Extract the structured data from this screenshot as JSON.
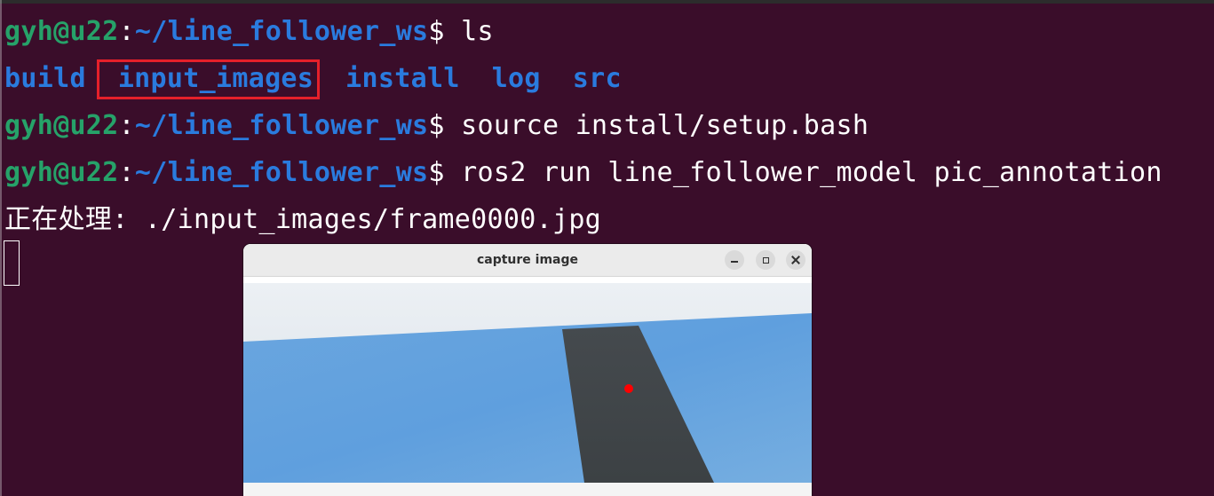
{
  "terminal": {
    "lines": [
      {
        "user": "gyh@u22",
        "sep": ":",
        "path": "~/line_follower_ws",
        "dollar": "$",
        "cmd": " ls"
      },
      {
        "dirs": [
          "build",
          "input_images",
          "install",
          "log",
          "src"
        ]
      },
      {
        "user": "gyh@u22",
        "sep": ":",
        "path": "~/line_follower_ws",
        "dollar": "$",
        "cmd": " source install/setup.bash"
      },
      {
        "user": "gyh@u22",
        "sep": ":",
        "path": "~/line_follower_ws",
        "dollar": "$",
        "cmd": " ros2 run line_follower_model pic_annotation"
      },
      {
        "output": "正在处理: ./input_images/frame0000.jpg"
      }
    ],
    "highlighted_dir": "input_images"
  },
  "window": {
    "title": "capture image",
    "buttons": [
      "minimize-icon",
      "maximize-icon",
      "close-icon"
    ]
  },
  "colors": {
    "terminal_bg": "#3a0d2a",
    "prompt_user": "#26a269",
    "prompt_path": "#2a7bde",
    "highlight_box": "#e5202a",
    "annotation_dot": "#ff0000"
  }
}
